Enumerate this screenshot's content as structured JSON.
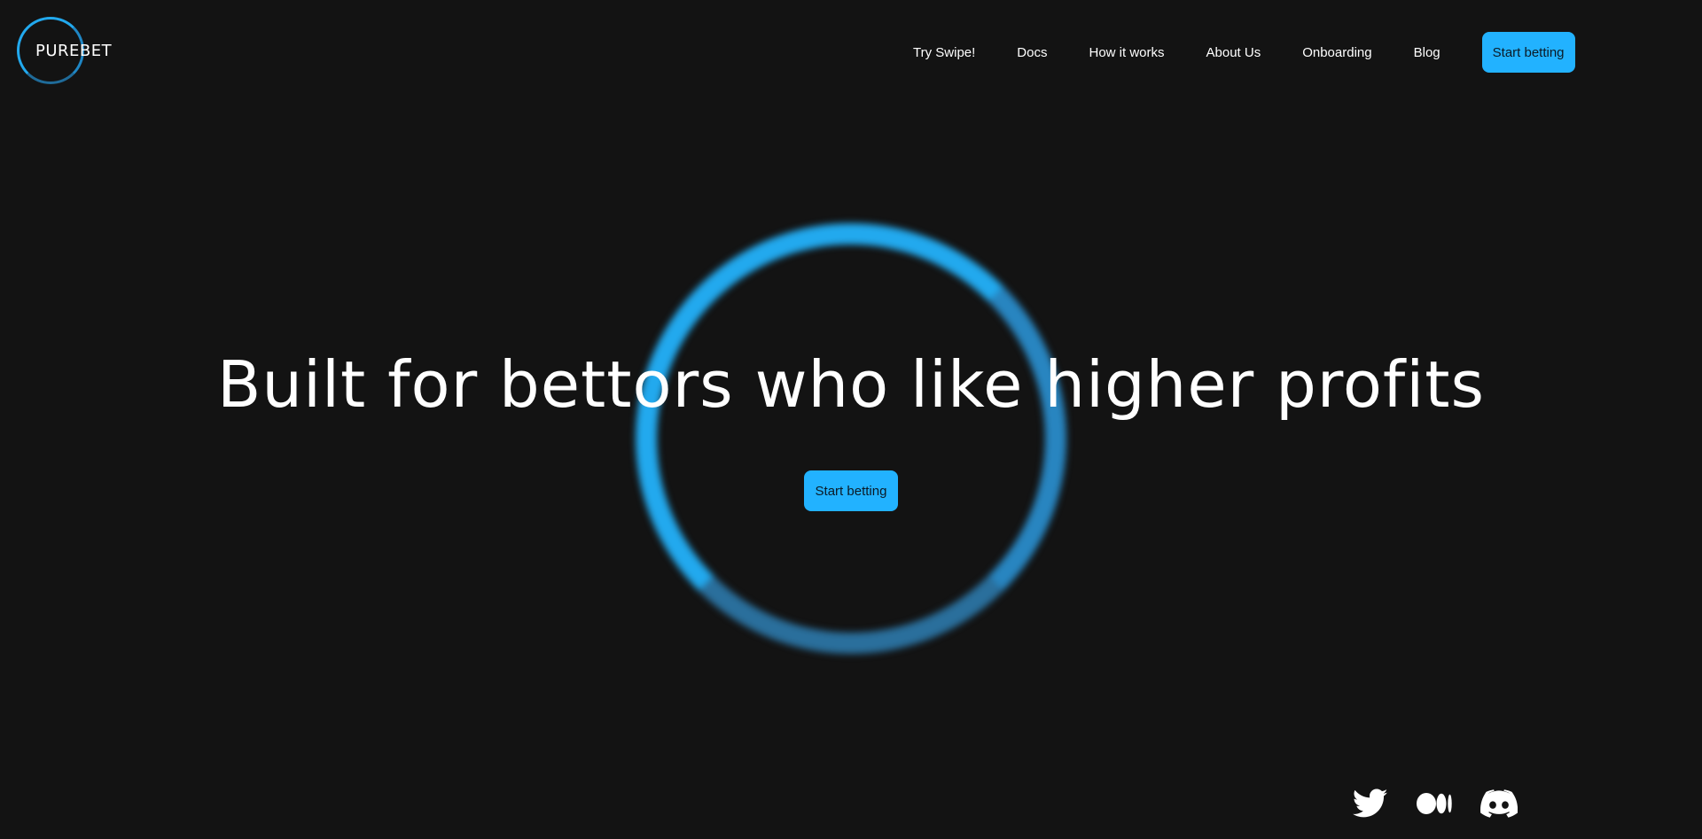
{
  "header": {
    "logo_text": "PUREBET",
    "nav": [
      {
        "label": "Try Swipe!"
      },
      {
        "label": "Docs"
      },
      {
        "label": "How it works"
      },
      {
        "label": "About Us"
      },
      {
        "label": "Onboarding"
      },
      {
        "label": "Blog"
      }
    ],
    "cta_label": "Start betting"
  },
  "hero": {
    "title": "Built for bettors who like higher profits",
    "cta_label": "Start betting"
  },
  "socials": [
    {
      "icon": "twitter-icon"
    },
    {
      "icon": "medium-icon"
    },
    {
      "icon": "discord-icon"
    }
  ],
  "colors": {
    "background": "#131313",
    "accent": "#22b2ff",
    "ring": "#22a9ee",
    "text": "#ffffff"
  }
}
